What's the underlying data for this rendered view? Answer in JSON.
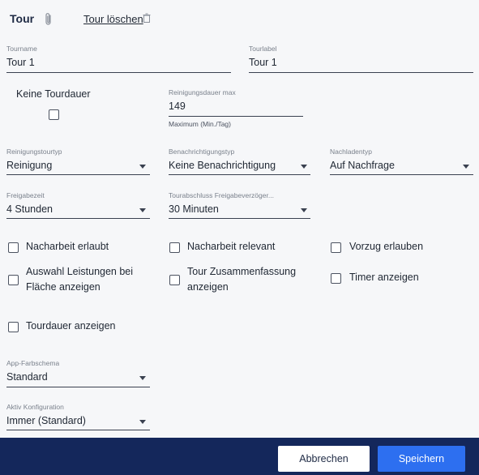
{
  "header": {
    "title": "Tour",
    "delete_link": "Tour löschen"
  },
  "fields": {
    "tourname": {
      "label": "Tourname",
      "value": "Tour 1"
    },
    "tourlabel": {
      "label": "Tourlabel",
      "value": "Tour 1"
    },
    "keine_tourdauer": {
      "label": "Keine Tourdauer",
      "checked": false
    },
    "reinigungsdauer": {
      "label": "Reinigungsdauer max",
      "value": "149",
      "hint": "Maximum (Min./Tag)"
    },
    "reinigungstourtyp": {
      "label": "Reinigungstourtyp",
      "value": "Reinigung"
    },
    "benachrichtigungstyp": {
      "label": "Benachrichtigungstyp",
      "value": "Keine Benachrichtigung"
    },
    "nachladentyp": {
      "label": "Nachladentyp",
      "value": "Auf Nachfrage"
    },
    "freigabezeit": {
      "label": "Freigabezeit",
      "value": "4 Stunden"
    },
    "tourabschluss": {
      "label": "Tourabschluss Freigabeverzöger...",
      "value": "30 Minuten"
    },
    "app_farbschema": {
      "label": "App-Farbschema",
      "value": "Standard"
    },
    "aktiv_konfiguration": {
      "label": "Aktiv Konfiguration",
      "value": "Immer (Standard)"
    }
  },
  "checkboxes": {
    "nacharbeit_erlaubt": {
      "label": "Nacharbeit erlaubt",
      "checked": false
    },
    "nacharbeit_relevant": {
      "label": "Nacharbeit relevant",
      "checked": false
    },
    "vorzug_erlauben": {
      "label": "Vorzug erlauben",
      "checked": false
    },
    "auswahl_leistungen": {
      "label": "Auswahl Leistungen bei Fläche anzeigen",
      "checked": false
    },
    "tour_zusammenfassung": {
      "label": "Tour Zusammenfassung anzeigen",
      "checked": false
    },
    "timer_anzeigen": {
      "label": "Timer anzeigen",
      "checked": false
    },
    "tourdauer_anzeigen": {
      "label": "Tourdauer anzeigen",
      "checked": false
    }
  },
  "footer": {
    "cancel_label": "Abbrechen",
    "save_label": "Speichern"
  },
  "icons": {
    "attachment": "paperclip-icon",
    "delete": "trash-icon",
    "dropdown": "caret-down-icon"
  },
  "colors": {
    "footer_bg": "#14275b",
    "primary": "#2d6ff0",
    "background": "#f6f7f9"
  }
}
